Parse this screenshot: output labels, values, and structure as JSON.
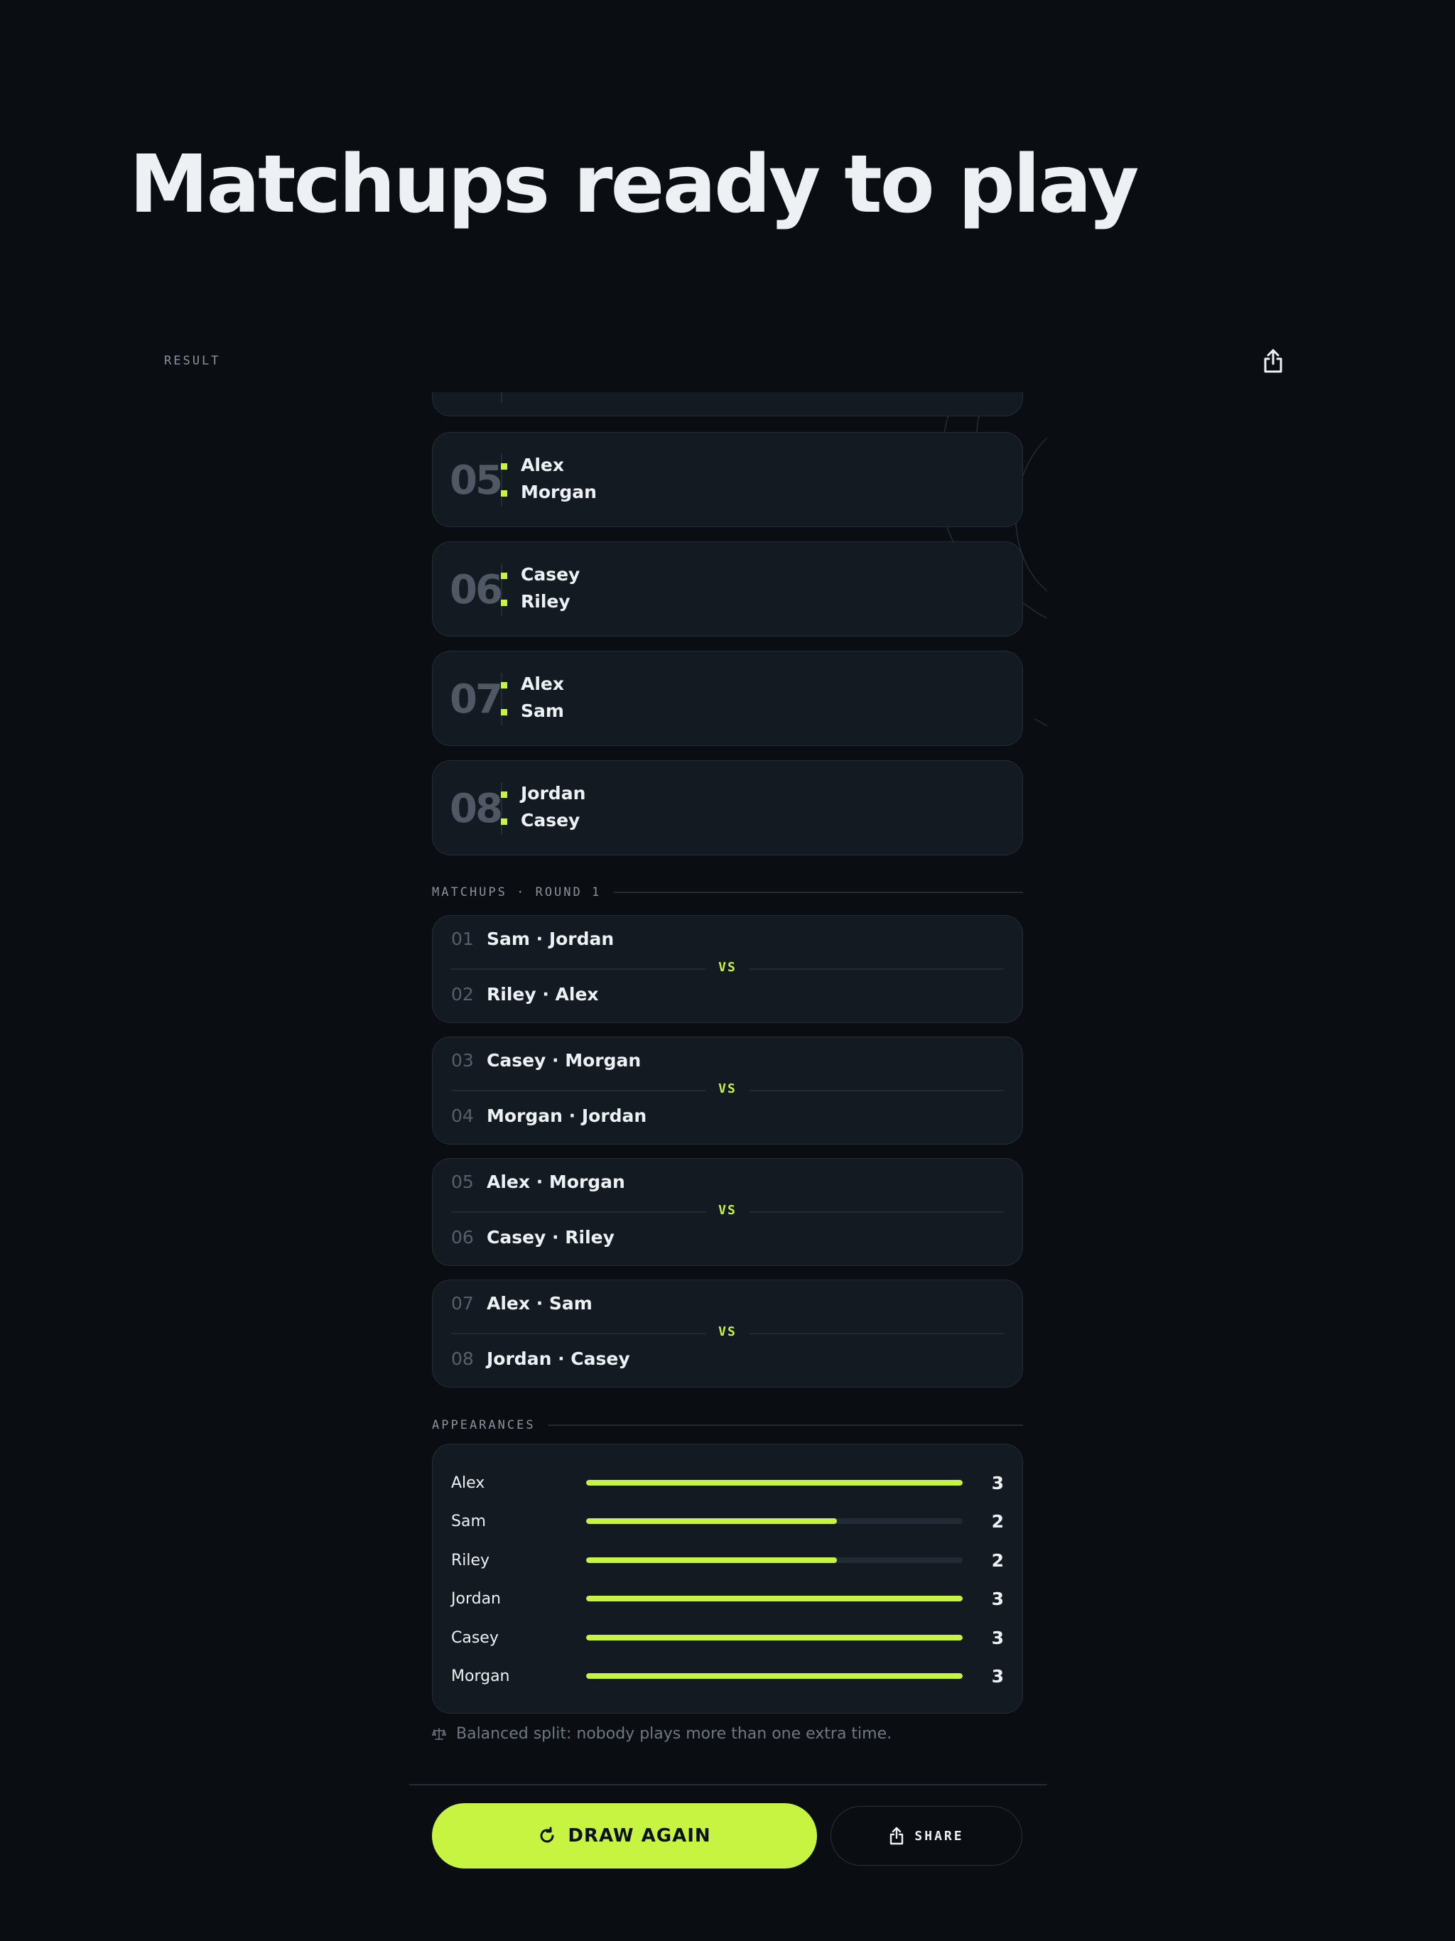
{
  "page": {
    "title": "Matchups ready to play"
  },
  "header": {
    "label": "RESULT",
    "share_icon": "share-icon"
  },
  "teams": [
    {
      "num": "05",
      "players": [
        "Alex",
        "Morgan"
      ]
    },
    {
      "num": "06",
      "players": [
        "Casey",
        "Riley"
      ]
    },
    {
      "num": "07",
      "players": [
        "Alex",
        "Sam"
      ]
    },
    {
      "num": "08",
      "players": [
        "Jordan",
        "Casey"
      ]
    }
  ],
  "matchups": {
    "title": "MATCHUPS · ROUND 1",
    "vs_label": "VS",
    "games": [
      {
        "top": {
          "num": "01",
          "team": "Sam · Jordan"
        },
        "bottom": {
          "num": "02",
          "team": "Riley · Alex"
        }
      },
      {
        "top": {
          "num": "03",
          "team": "Casey · Morgan"
        },
        "bottom": {
          "num": "04",
          "team": "Morgan · Jordan"
        }
      },
      {
        "top": {
          "num": "05",
          "team": "Alex · Morgan"
        },
        "bottom": {
          "num": "06",
          "team": "Casey · Riley"
        }
      },
      {
        "top": {
          "num": "07",
          "team": "Alex · Sam"
        },
        "bottom": {
          "num": "08",
          "team": "Jordan · Casey"
        }
      }
    ]
  },
  "appearances": {
    "title": "APPEARANCES",
    "max": 3,
    "rows": [
      {
        "name": "Alex",
        "count": 3
      },
      {
        "name": "Sam",
        "count": 2
      },
      {
        "name": "Riley",
        "count": 2
      },
      {
        "name": "Jordan",
        "count": 3
      },
      {
        "name": "Casey",
        "count": 3
      },
      {
        "name": "Morgan",
        "count": 3
      }
    ],
    "note": "Balanced split: nobody plays more than one extra time.",
    "note_icon": "scale-icon"
  },
  "actions": {
    "draw_again": "DRAW AGAIN",
    "draw_icon": "refresh-icon",
    "share": "SHARE",
    "share_icon": "share-icon"
  },
  "colors": {
    "accent": "#c7f440",
    "background": "#0a0d12",
    "card": "#141a22"
  }
}
